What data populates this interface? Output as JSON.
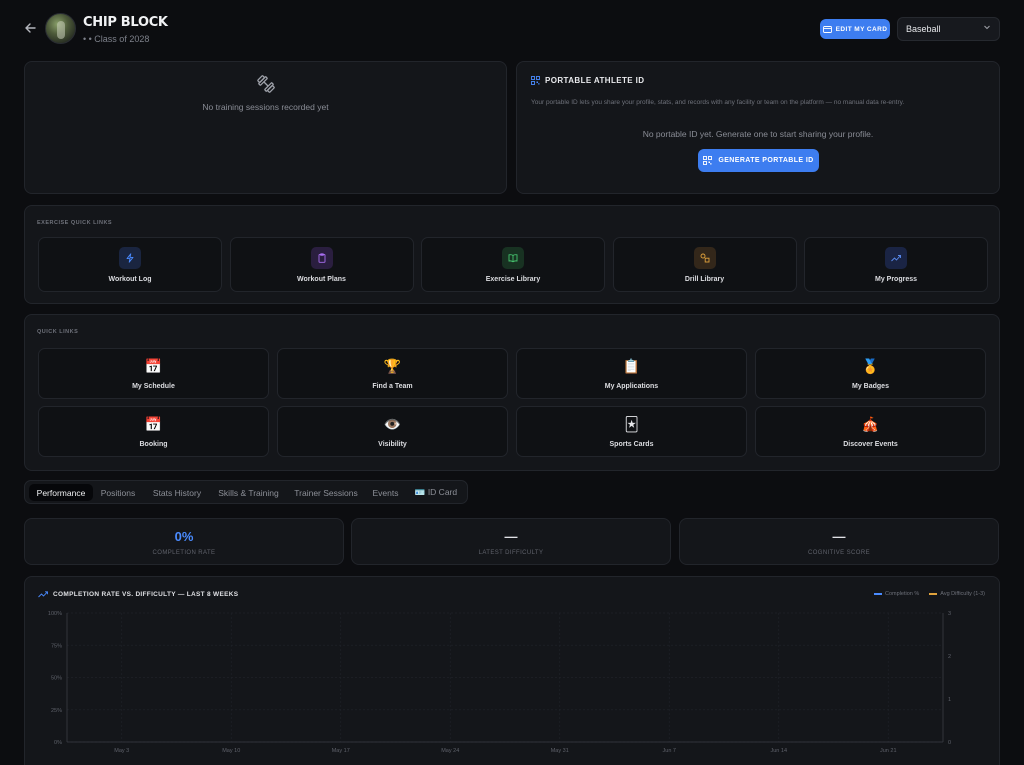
{
  "header": {
    "name": "CHIP BLOCK",
    "subtitle": "• • Class of 2028",
    "edit_card_label": "EDIT MY CARD",
    "sport_selected": "Baseball"
  },
  "training": {
    "empty_text": "No training sessions recorded yet"
  },
  "portable_id": {
    "title": "PORTABLE ATHLETE ID",
    "description": "Your portable ID lets you share your profile, stats, and records with any facility or team on the platform — no manual data re-entry.",
    "empty_text": "No portable ID yet. Generate one to start sharing your profile.",
    "generate_label": "GENERATE PORTABLE ID"
  },
  "exercise_links": {
    "label": "EXERCISE QUICK LINKS",
    "items": [
      {
        "label": "Workout Log",
        "icon": "lightning-icon",
        "color": "#4a8bff",
        "bg": "#1a2540"
      },
      {
        "label": "Workout Plans",
        "icon": "clipboard-icon",
        "color": "#a86ef0",
        "bg": "#2a1e3f"
      },
      {
        "label": "Exercise Library",
        "icon": "book-icon",
        "color": "#46c46f",
        "bg": "#183222"
      },
      {
        "label": "Drill Library",
        "icon": "shapes-icon",
        "color": "#e0a23c",
        "bg": "#33271a"
      },
      {
        "label": "My Progress",
        "icon": "trend-icon",
        "color": "#5a8cf0",
        "bg": "#1a2444"
      }
    ]
  },
  "quick_links": {
    "label": "QUICK LINKS",
    "items": [
      {
        "label": "My Schedule",
        "emoji": "📅",
        "icon": "calendar-icon"
      },
      {
        "label": "Find a Team",
        "emoji": "🏆",
        "icon": "trophy-icon"
      },
      {
        "label": "My Applications",
        "emoji": "📋",
        "icon": "clipboard-icon"
      },
      {
        "label": "My Badges",
        "emoji": "🏅",
        "icon": "medal-icon"
      },
      {
        "label": "Booking",
        "emoji": "📅",
        "icon": "calendar-icon"
      },
      {
        "label": "Visibility",
        "emoji": "👁️",
        "icon": "eye-icon"
      },
      {
        "label": "Sports Cards",
        "emoji": "🃏",
        "icon": "card-icon"
      },
      {
        "label": "Discover Events",
        "emoji": "🎪",
        "icon": "tent-icon"
      }
    ]
  },
  "tabs": [
    {
      "label": "Performance",
      "active": true
    },
    {
      "label": "Positions"
    },
    {
      "label": "Stats History"
    },
    {
      "label": "Skills & Training"
    },
    {
      "label": "Trainer Sessions"
    },
    {
      "label": "Events"
    },
    {
      "label": "🪪 ID Card"
    }
  ],
  "stats": [
    {
      "value": "0%",
      "label": "COMPLETION RATE"
    },
    {
      "value": "—",
      "label": "LATEST DIFFICULTY"
    },
    {
      "value": "—",
      "label": "COGNITIVE SCORE"
    }
  ],
  "chart_data": {
    "type": "line",
    "title": "COMPLETION RATE VS. DIFFICULTY — LAST 8 WEEKS",
    "categories": [
      "May 3",
      "May 10",
      "May 17",
      "May 24",
      "May 31",
      "Jun 7",
      "Jun 14",
      "Jun 21"
    ],
    "series": [
      {
        "name": "Completion %",
        "values": [],
        "color": "#4a8bff",
        "axis": "left"
      },
      {
        "name": "Avg Difficulty (1-3)",
        "values": [],
        "color": "#e0a23c",
        "axis": "right"
      }
    ],
    "y_left": {
      "ticks": [
        "0%",
        "25%",
        "50%",
        "75%",
        "100%"
      ],
      "lim": [
        0,
        100
      ]
    },
    "y_right": {
      "ticks": [
        "0",
        "1",
        "2",
        "3"
      ],
      "lim": [
        0,
        3
      ]
    },
    "grid": true,
    "legend": "top-right"
  }
}
